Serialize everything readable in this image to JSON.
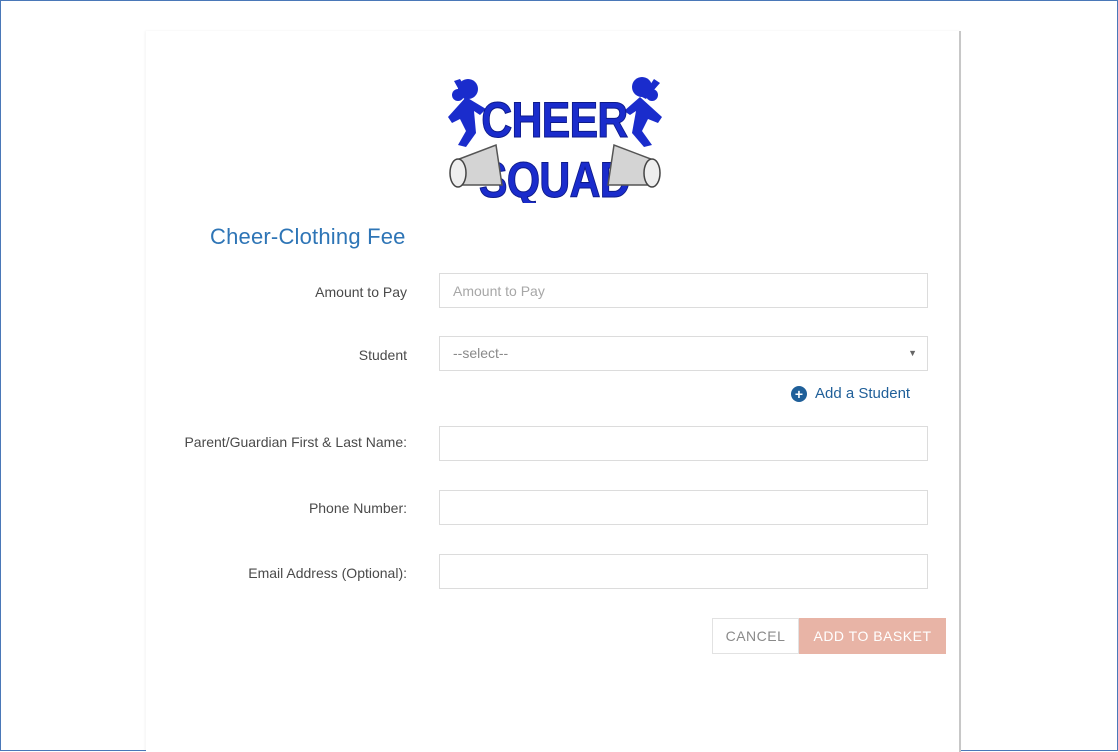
{
  "page": {
    "title": "Cheer-Clothing Fee",
    "logo_alt": "CHEER SQUAD",
    "accent_color": "#2e75b6"
  },
  "form": {
    "amount": {
      "label": "Amount to Pay",
      "placeholder": "Amount to Pay",
      "value": ""
    },
    "student": {
      "label": "Student",
      "selected": "--select--"
    },
    "add_student": {
      "label": "Add a Student",
      "icon": "plus-circle-icon"
    },
    "parent_name": {
      "label": "Parent/Guardian First & Last Name:",
      "value": ""
    },
    "phone": {
      "label": "Phone Number:",
      "value": ""
    },
    "email": {
      "label": "Email Address (Optional):",
      "value": ""
    }
  },
  "actions": {
    "cancel_label": "CANCEL",
    "add_label": "ADD TO BASKET",
    "add_color": "#e8b4a6"
  }
}
